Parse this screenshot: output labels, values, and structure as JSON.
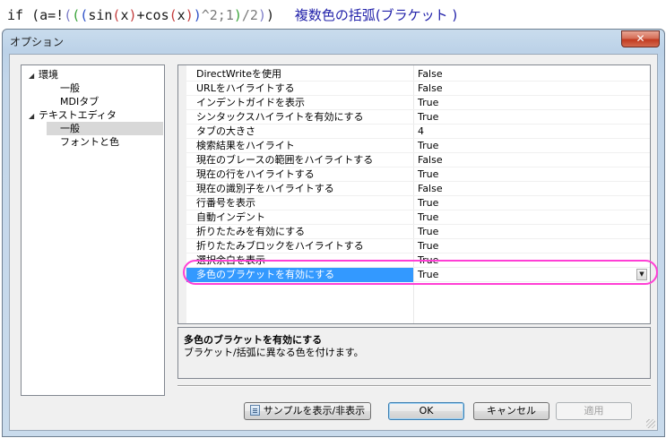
{
  "code_banner": {
    "tokens": [
      {
        "text": "if (a=!",
        "color": "#1a1a1a"
      },
      {
        "text": "(",
        "color": "#7d7dc8"
      },
      {
        "text": "(",
        "color": "#39a339"
      },
      {
        "text": "(",
        "color": "#2b4fc7"
      },
      {
        "text": "sin",
        "color": "#1a1a1a"
      },
      {
        "text": "(",
        "color": "#c43c3c"
      },
      {
        "text": "x",
        "color": "#1a1a1a"
      },
      {
        "text": ")",
        "color": "#c43c3c"
      },
      {
        "text": "+cos",
        "color": "#1a1a1a"
      },
      {
        "text": "(",
        "color": "#c43c3c"
      },
      {
        "text": "x",
        "color": "#1a1a1a"
      },
      {
        "text": ")",
        "color": "#c43c3c"
      },
      {
        "text": ")",
        "color": "#2b4fc7"
      },
      {
        "text": "^2;1",
        "color": "#7a7a7a"
      },
      {
        "text": ")",
        "color": "#39a339"
      },
      {
        "text": "/2",
        "color": "#7a7a7a"
      },
      {
        "text": ")",
        "color": "#7d7dc8"
      },
      {
        "text": ")",
        "color": "#1a1a1a"
      }
    ],
    "caption": "複数色の括弧(ブラケット )",
    "caption_color": "#2222aa"
  },
  "dialog": {
    "title": "オプション",
    "close_glyph": "✕"
  },
  "tree": {
    "items": [
      {
        "label": "環境",
        "arrow": "◢",
        "level": 0
      },
      {
        "label": "一般",
        "arrow": "",
        "level": 1
      },
      {
        "label": "MDIタブ",
        "arrow": "",
        "level": 1
      },
      {
        "label": "テキストエディタ",
        "arrow": "◢",
        "level": 0
      },
      {
        "label": "一般",
        "arrow": "",
        "level": 1,
        "selected": true
      },
      {
        "label": "フォントと色",
        "arrow": "",
        "level": 1
      }
    ]
  },
  "grid": {
    "rows": [
      {
        "name": "DirectWriteを使用",
        "value": "False"
      },
      {
        "name": "URLをハイライトする",
        "value": "False"
      },
      {
        "name": "インデントガイドを表示",
        "value": "True"
      },
      {
        "name": "シンタックスハイライトを有効にする",
        "value": "True"
      },
      {
        "name": "タブの大きさ",
        "value": "4"
      },
      {
        "name": "検索結果をハイライト",
        "value": "True"
      },
      {
        "name": "現在のブレースの範囲をハイライトする",
        "value": "False"
      },
      {
        "name": "現在の行をハイライトする",
        "value": "True"
      },
      {
        "name": "現在の識別子をハイライトする",
        "value": "False"
      },
      {
        "name": "行番号を表示",
        "value": "True"
      },
      {
        "name": "自動インデント",
        "value": "True"
      },
      {
        "name": "折りたたみを有効にする",
        "value": "True"
      },
      {
        "name": "折りたたみブロックをハイライトする",
        "value": "True"
      },
      {
        "name": "選択余白を表示",
        "value": "True"
      },
      {
        "name": "多色のブラケットを有効にする",
        "value": "True",
        "selected": true
      }
    ],
    "dropdown_glyph": "▼",
    "selected_color": "#3399ff",
    "highlight_ring_color": "#ff3fd5"
  },
  "description": {
    "title": "多色のブラケットを有効にする",
    "text": "ブラケット/括弧に異なる色を付けます。"
  },
  "buttons": {
    "toggle_sample": "サンプルを表示/非表示",
    "ok": "OK",
    "cancel": "キャンセル",
    "apply": "適用"
  }
}
